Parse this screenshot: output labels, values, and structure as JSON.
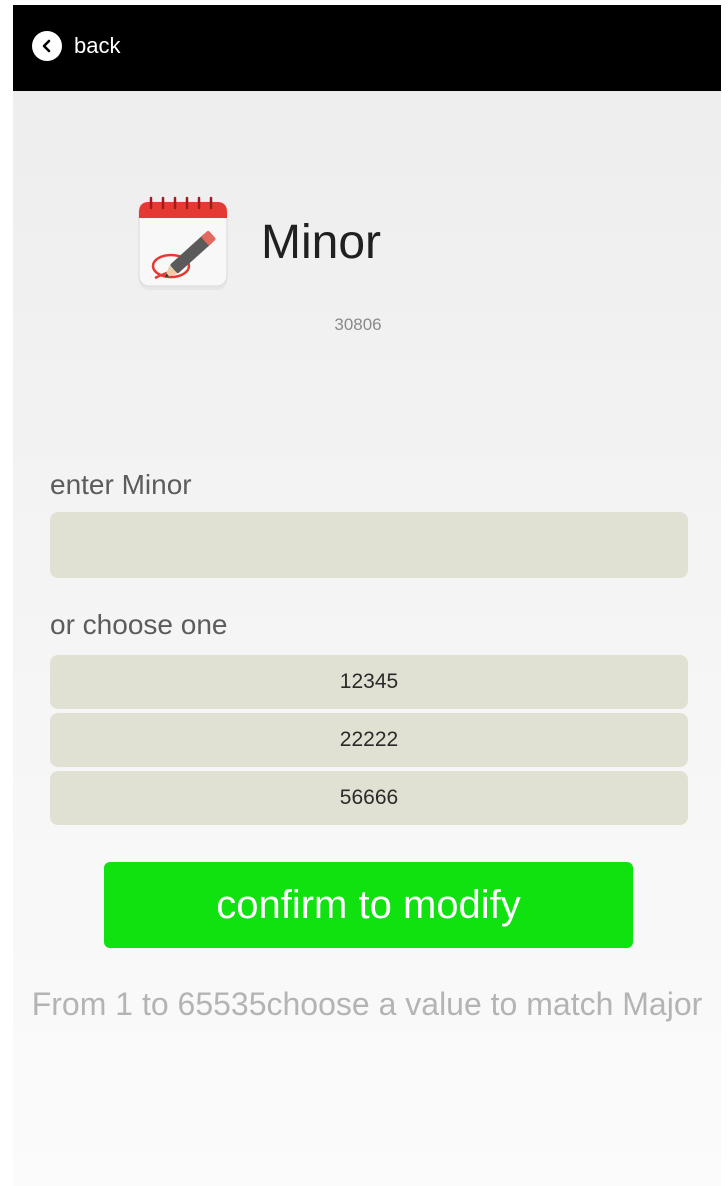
{
  "header": {
    "back_label": "back",
    "background": "#000000",
    "icon": "chevron-left-icon"
  },
  "main": {
    "title": "Minor",
    "app_icon": "notepad-pencil-icon",
    "current_value": "30806",
    "enter_label": "enter Minor",
    "input_value": "",
    "choose_label": "or choose one",
    "options": [
      "12345",
      "22222",
      "56666"
    ],
    "confirm_label": "confirm to modify",
    "confirm_color": "#10e20f",
    "hint": "From 1 to 65535choose a value to match Major"
  }
}
